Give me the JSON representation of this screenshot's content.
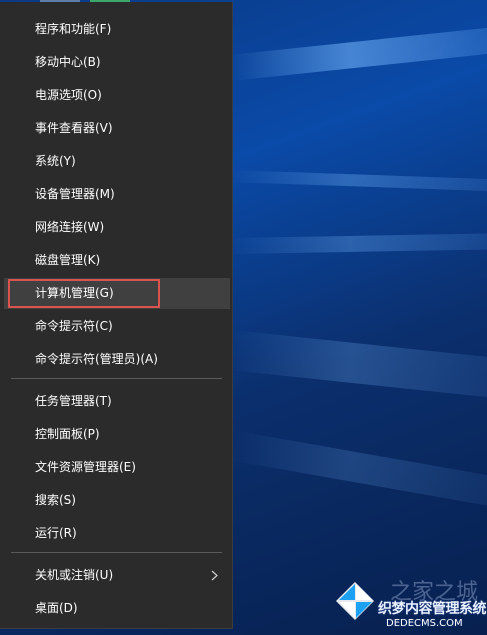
{
  "menu": {
    "items": [
      {
        "label": "程序和功能(F)"
      },
      {
        "label": "移动中心(B)"
      },
      {
        "label": "电源选项(O)"
      },
      {
        "label": "事件查看器(V)"
      },
      {
        "label": "系统(Y)"
      },
      {
        "label": "设备管理器(M)"
      },
      {
        "label": "网络连接(W)"
      },
      {
        "label": "磁盘管理(K)"
      },
      {
        "label": "计算机管理(G)",
        "highlighted": true
      },
      {
        "label": "命令提示符(C)"
      },
      {
        "label": "命令提示符(管理员)(A)"
      },
      {
        "label": "任务管理器(T)"
      },
      {
        "label": "控制面板(P)"
      },
      {
        "label": "文件资源管理器(E)"
      },
      {
        "label": "搜索(S)"
      },
      {
        "label": "运行(R)"
      },
      {
        "label": "关机或注销(U)",
        "submenu": true
      },
      {
        "label": "桌面(D)"
      }
    ]
  },
  "annotation": {
    "color": "#d9534f"
  },
  "watermark": {
    "faint_text": "之家之城",
    "title": "织梦内容管理系统",
    "url": "DEDECMS.COM"
  },
  "colors": {
    "menu_bg": "#2b2b2b",
    "menu_text": "#ffffff",
    "highlight_bg": "#404040",
    "desktop_blue": "#0a4aa8"
  }
}
